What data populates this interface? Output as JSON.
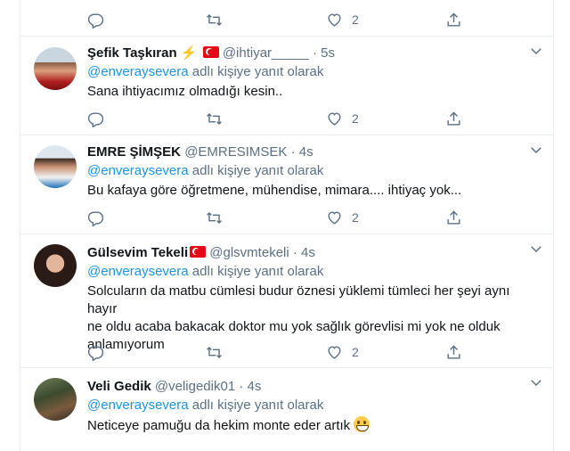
{
  "top_actions": {
    "like_count": "2"
  },
  "tweets": [
    {
      "name": "Şefik Taşkıran",
      "handle": "@ihtiyar_____",
      "time": "5s",
      "replying_prefix": "",
      "mention": "@enveraysevera",
      "replying_suffix": " adlı kişiye yanıt olarak",
      "text": "Sana ihtiyacımız olmadığı kesin..",
      "like_count": "2",
      "badges": [
        "lightning-emoji",
        "turkey-flag-emoji"
      ]
    },
    {
      "name": "EMRE ŞİMŞEK",
      "handle": "@EMRESIMSEK",
      "time": "4s",
      "mention": "@enveraysevera",
      "replying_suffix": " adlı kişiye yanıt olarak",
      "text": "Bu kafaya göre öğretmene, mühendise, mimara.... ihtiyaç yok...",
      "like_count": "2"
    },
    {
      "name": "Gülsevim Tekeli",
      "handle": "@glsvmtekeli",
      "time": "4s",
      "mention": "@enveraysevera",
      "replying_suffix": " adlı kişiye yanıt olarak",
      "text_lines": [
        "Solcuların da matbu cümlesi budur öznesi yüklemi tümleci her şeyi aynı hayır",
        "ne oldu acaba bakacak doktor mu yok sağlık görevlisi mi yok ne olduk",
        "anlamıyorum"
      ],
      "like_count": "2",
      "badges": [
        "turkey-flag-emoji"
      ]
    },
    {
      "name": "Veli Gedik",
      "handle": "@veligedik01",
      "time": "4s",
      "mention": "@enveraysevera",
      "replying_suffix": " adlı kişiye yanıt olarak",
      "text": "Neticeye pamuğu da hekim monte eder artık",
      "badges": [
        "grinning-emoji"
      ]
    }
  ],
  "colors": {
    "accent": "#1b95e0",
    "muted": "#5b7083",
    "border": "#e6ecf0",
    "flag": "#e30a17"
  },
  "icons": [
    "reply-icon",
    "retweet-icon",
    "like-icon",
    "share-icon",
    "caret-down-icon"
  ]
}
